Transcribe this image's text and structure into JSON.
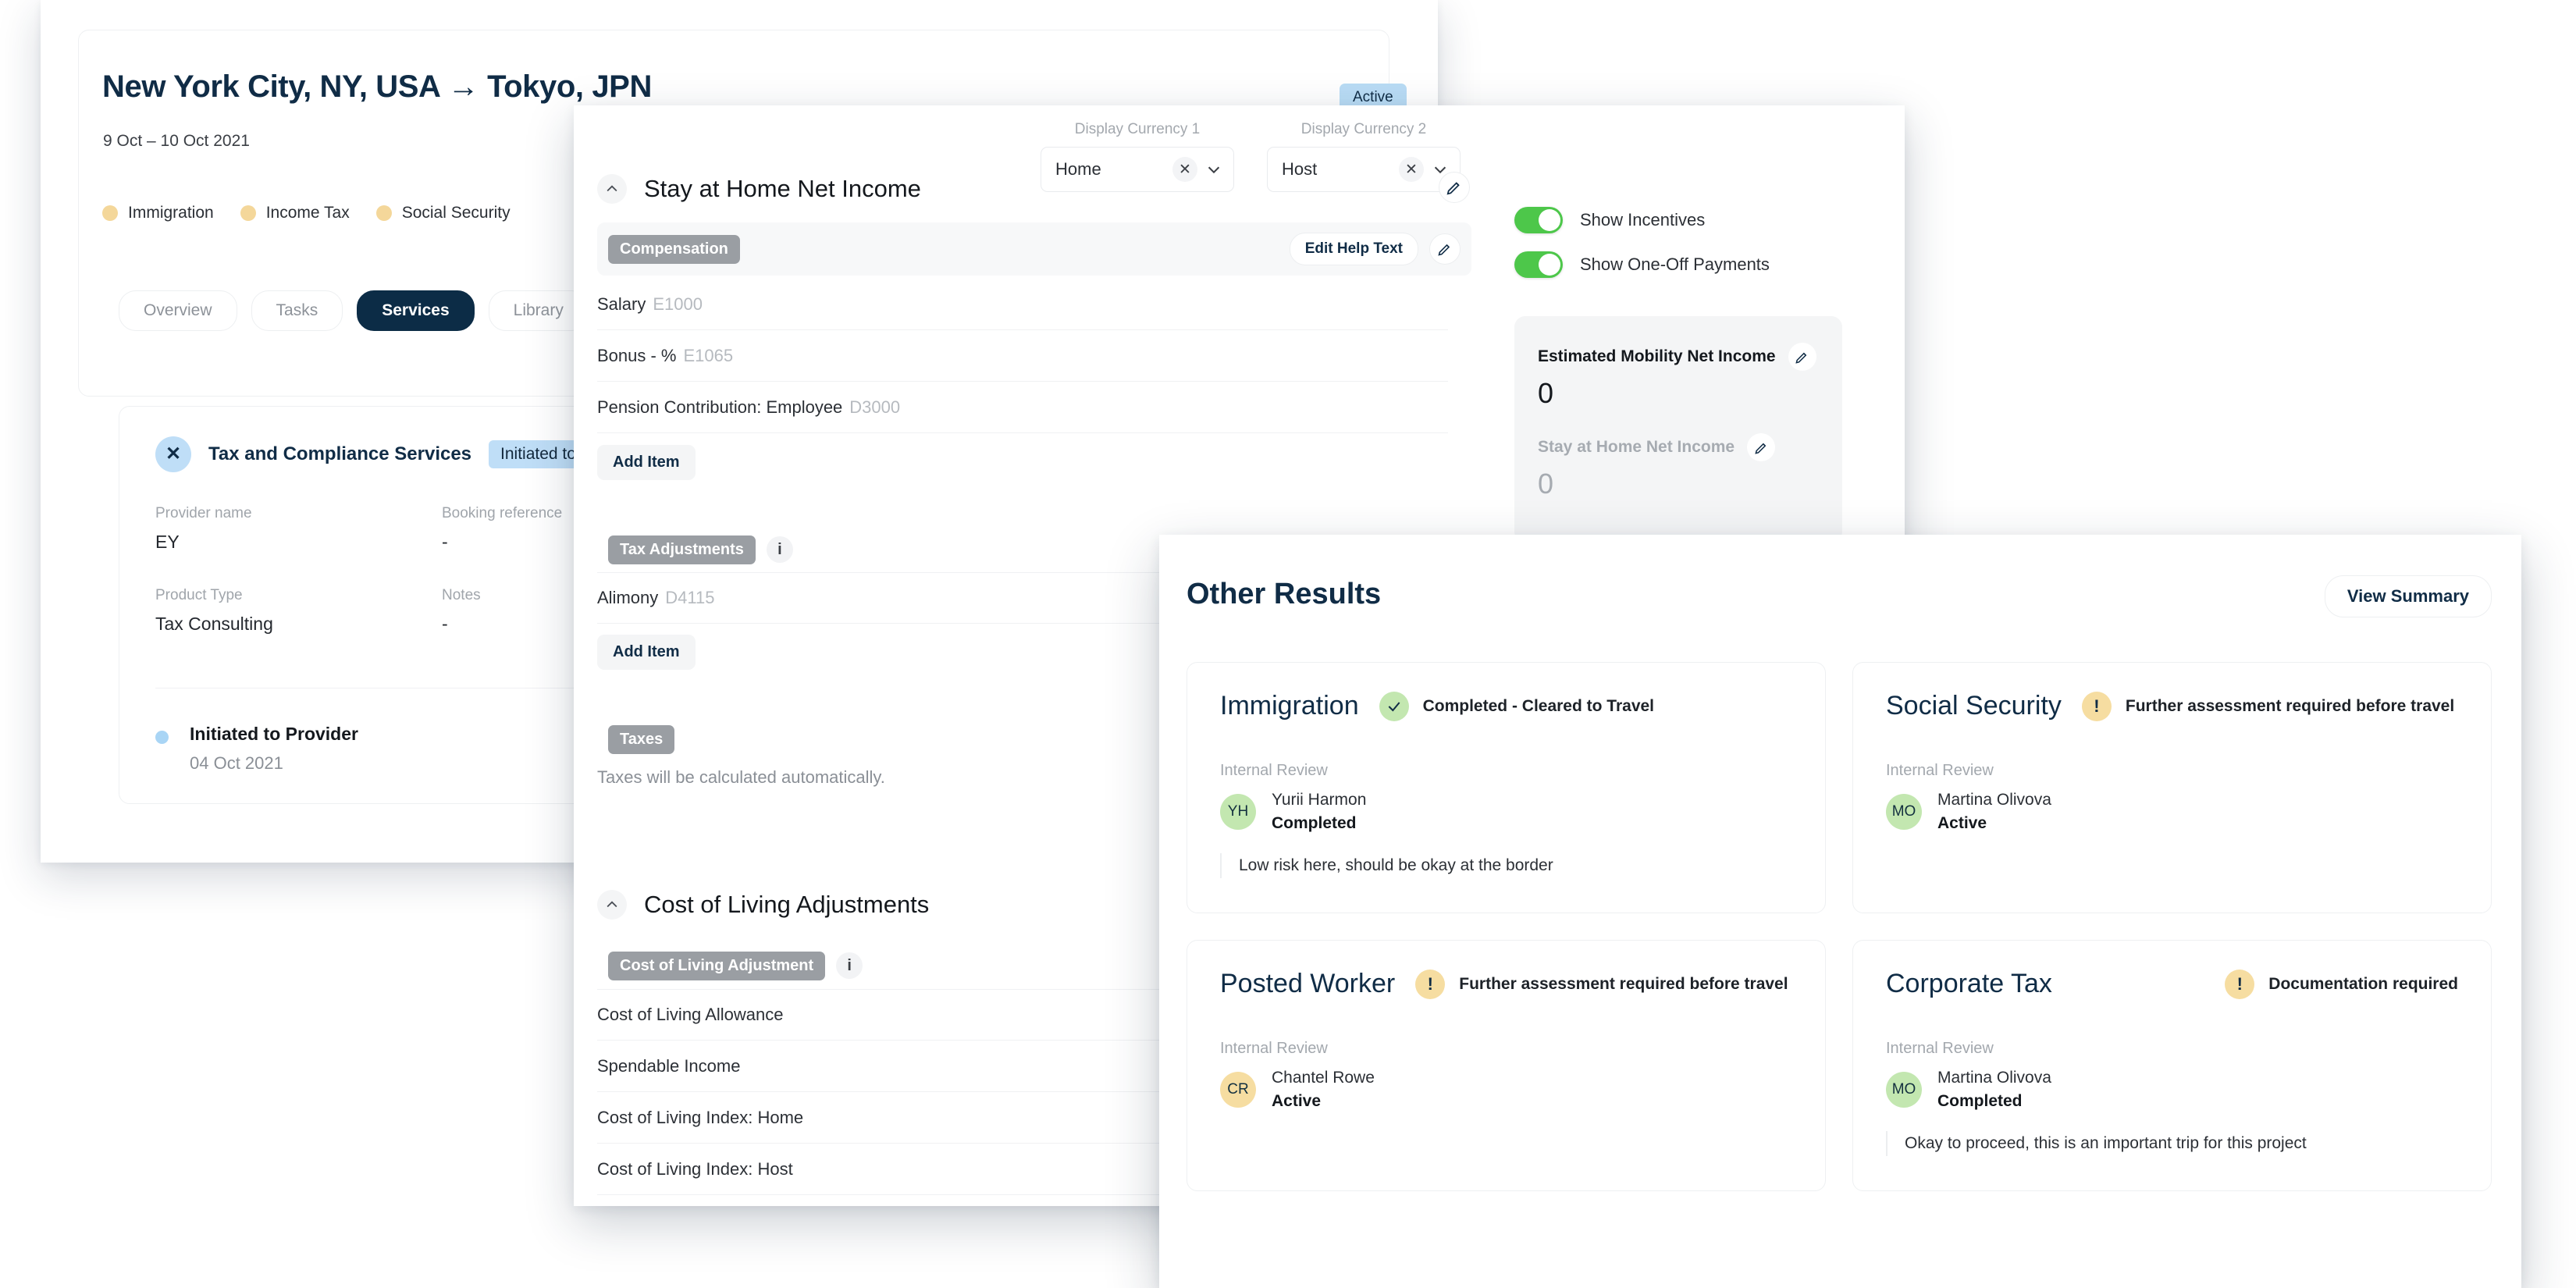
{
  "trip": {
    "title": "New York City, NY, USA → Tokyo, JPN",
    "dates": "9 Oct – 10 Oct 2021",
    "status_badge": "Active",
    "chips": [
      {
        "label": "Immigration"
      },
      {
        "label": "Income Tax"
      },
      {
        "label": "Social Security"
      }
    ],
    "tabs": [
      {
        "label": "Overview",
        "active": false
      },
      {
        "label": "Tasks",
        "active": false
      },
      {
        "label": "Services",
        "active": true
      },
      {
        "label": "Library",
        "active": false
      },
      {
        "label": "",
        "active": false
      }
    ],
    "service": {
      "close_icon": "close-icon",
      "name": "Tax and Compliance Services",
      "badge": "Initiated to Provider",
      "fields": [
        {
          "label": "Provider name",
          "value": "EY"
        },
        {
          "label": "Booking reference",
          "value": "-"
        },
        {
          "label": "Product Type",
          "value": "Tax Consulting"
        },
        {
          "label": "Notes",
          "value": "-"
        }
      ],
      "status_title": "Initiated to Provider",
      "status_date": "04 Oct 2021"
    }
  },
  "compensation": {
    "currencies": [
      {
        "label": "Display Currency 1",
        "value": "Home",
        "clear_icon": "close-icon",
        "chevron_icon": "chevron-down-icon"
      },
      {
        "label": "Display Currency 2",
        "value": "Host",
        "clear_icon": "close-icon",
        "chevron_icon": "chevron-down-icon"
      }
    ],
    "toggles": [
      {
        "label": "Show Incentives",
        "on": true
      },
      {
        "label": "Show One-Off Payments",
        "on": true
      }
    ],
    "net_income": [
      {
        "label": "Estimated Mobility Net Income",
        "value": "0",
        "muted": false
      },
      {
        "label": "Stay at Home Net Income",
        "value": "0",
        "muted": true
      }
    ],
    "sections": [
      {
        "title": "Stay at Home Net Income",
        "groups": [
          {
            "tag": "Compensation",
            "has_info": false,
            "edit_help_text": "Edit Help Text",
            "rows": [
              {
                "label": "Salary",
                "code": "E1000"
              },
              {
                "label": "Bonus - %",
                "code": "E1065"
              },
              {
                "label": "Pension Contribution: Employee",
                "code": "D3000"
              }
            ],
            "add_item": "Add Item"
          },
          {
            "tag": "Tax Adjustments",
            "has_info": true,
            "rows": [
              {
                "label": "Alimony",
                "code": "D4115"
              }
            ],
            "add_item": "Add Item"
          },
          {
            "tag": "Taxes",
            "has_info": false,
            "note": "Taxes will be calculated automatically."
          }
        ]
      },
      {
        "title": "Cost of Living Adjustments",
        "groups": [
          {
            "tag": "Cost of Living Adjustment",
            "has_info": true,
            "rows": [
              {
                "label": "Cost of Living Allowance",
                "code": ""
              },
              {
                "label": "Spendable Income",
                "code": ""
              },
              {
                "label": "Cost of Living Index: Home",
                "code": ""
              },
              {
                "label": "Cost of Living Index: Host",
                "code": ""
              }
            ]
          }
        ]
      }
    ]
  },
  "other_results": {
    "title": "Other Results",
    "view_summary": "View Summary",
    "cards": [
      {
        "title": "Immigration",
        "status_text": "Completed - Cleared to Travel",
        "status_kind": "ok",
        "status_icon": "check-icon",
        "review_label": "Internal Review",
        "reviewer_initials": "YH",
        "reviewer_avatar_color": "green",
        "reviewer_name": "Yurii Harmon",
        "reviewer_state": "Completed",
        "note": "Low risk here, should be okay at the border"
      },
      {
        "title": "Social Security",
        "status_text": "Further assessment required before travel",
        "status_kind": "warn",
        "status_icon": "exclamation-icon",
        "review_label": "Internal Review",
        "reviewer_initials": "MO",
        "reviewer_avatar_color": "green",
        "reviewer_name": "Martina Olivova",
        "reviewer_state": "Active",
        "note": ""
      },
      {
        "title": "Posted Worker",
        "status_text": "Further assessment required before travel",
        "status_kind": "warn",
        "status_icon": "exclamation-icon",
        "review_label": "Internal Review",
        "reviewer_initials": "CR",
        "reviewer_avatar_color": "yellow",
        "reviewer_name": "Chantel Rowe",
        "reviewer_state": "Active",
        "note": ""
      },
      {
        "title": "Corporate Tax",
        "status_text": "Documentation required",
        "status_kind": "warn",
        "status_icon": "exclamation-icon",
        "review_label": "Internal Review",
        "reviewer_initials": "MO",
        "reviewer_avatar_color": "green",
        "reviewer_name": "Martina Olivova",
        "reviewer_state": "Completed",
        "note": "Okay to proceed, this is an important trip for this project"
      }
    ]
  },
  "colors": {
    "brand_navy": "#102c46",
    "badge_blue": "#bfdef7",
    "chip_yellow": "#f4d79a",
    "toggle_green": "#4dc74a",
    "status_green": "#c3e7b0",
    "status_yellow": "#f6dda1"
  }
}
